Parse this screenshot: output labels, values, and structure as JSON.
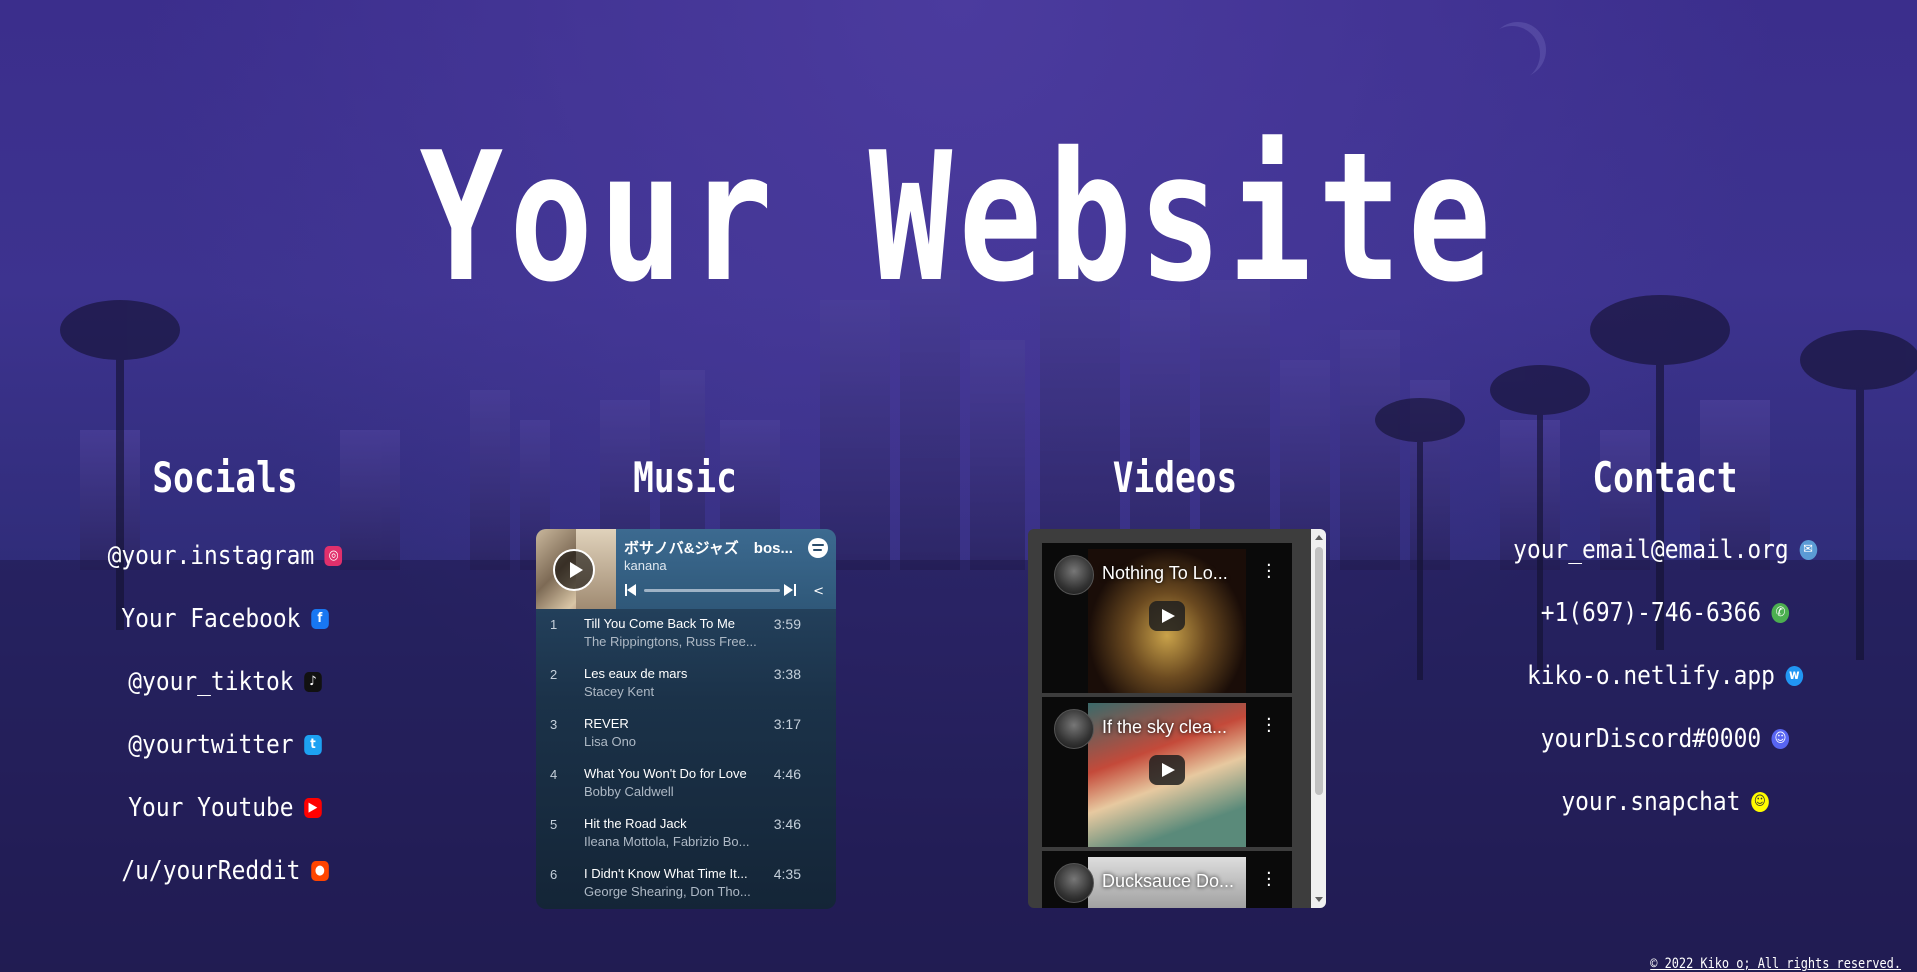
{
  "site": {
    "title": "Your Website",
    "footer": "© 2022 Kiko o; All rights reserved."
  },
  "socials": {
    "heading": "Socials",
    "items": [
      {
        "label": "@your.instagram",
        "icon": "instagram-icon",
        "color": "#e1306c"
      },
      {
        "label": "Your Facebook",
        "icon": "facebook-icon",
        "color": "#1877f2"
      },
      {
        "label": "@your_tiktok",
        "icon": "tiktok-icon",
        "color": "#111111"
      },
      {
        "label": "@yourtwitter",
        "icon": "twitter-icon",
        "color": "#1da1f2"
      },
      {
        "label": "Your Youtube",
        "icon": "youtube-icon",
        "color": "#ff0000"
      },
      {
        "label": "/u/yourReddit",
        "icon": "reddit-icon",
        "color": "#ff4500"
      }
    ]
  },
  "music": {
    "heading": "Music",
    "player": {
      "playlist_title": "ボサノバ&ジャズ　bos...",
      "artist": "kanana",
      "tracks": [
        {
          "num": "1",
          "name": "Till You Come Back To Me",
          "artist": "The Rippingtons, Russ Free...",
          "duration": "3:59"
        },
        {
          "num": "2",
          "name": "Les eaux de mars",
          "artist": "Stacey Kent",
          "duration": "3:38"
        },
        {
          "num": "3",
          "name": "REVER",
          "artist": "Lisa Ono",
          "duration": "3:17"
        },
        {
          "num": "4",
          "name": "What You Won't Do for Love",
          "artist": "Bobby Caldwell",
          "duration": "4:46"
        },
        {
          "num": "5",
          "name": "Hit the Road Jack",
          "artist": "Ileana Mottola, Fabrizio Bo...",
          "duration": "3:46"
        },
        {
          "num": "6",
          "name": "I Didn't Know What Time It...",
          "artist": "George Shearing, Don Tho...",
          "duration": "4:35"
        }
      ]
    }
  },
  "videos": {
    "heading": "Videos",
    "items": [
      {
        "title": "Nothing To Lo..."
      },
      {
        "title": "If the sky clea..."
      },
      {
        "title": "Ducksauce Do..."
      }
    ]
  },
  "contact": {
    "heading": "Contact",
    "items": [
      {
        "label": "your_email@email.org",
        "icon": "email-icon",
        "color": "#5b9bd5"
      },
      {
        "label": "+1(697)-746-6366",
        "icon": "phone-icon",
        "color": "#4caf50"
      },
      {
        "label": "kiko-o.netlify.app",
        "icon": "www-icon",
        "color": "#2196f3"
      },
      {
        "label": "yourDiscord#0000",
        "icon": "discord-icon",
        "color": "#5865f2"
      },
      {
        "label": "your.snapchat",
        "icon": "snapchat-icon",
        "color": "#fffc00"
      }
    ]
  }
}
